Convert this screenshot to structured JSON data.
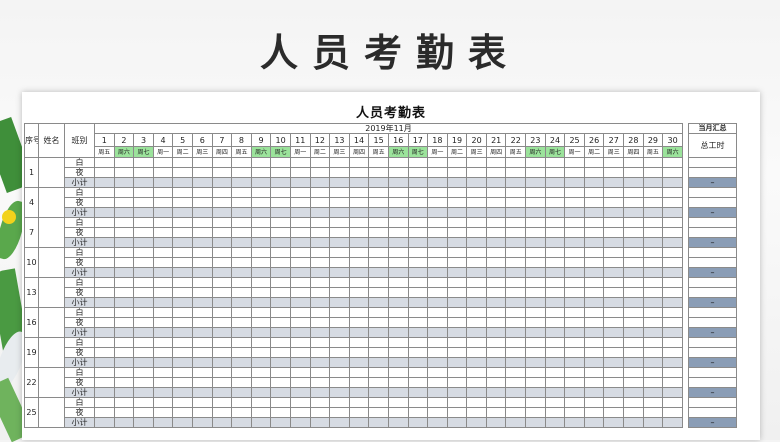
{
  "page_title": "人员考勤表",
  "sheet": {
    "title": "人员考勤表",
    "month": "2019年11月",
    "headers": {
      "seq": "序号",
      "name": "姓名",
      "shift": "班别",
      "summary": "当月汇总",
      "total_hours": "总工时"
    },
    "days": [
      {
        "n": "1",
        "w": "周五",
        "we": false
      },
      {
        "n": "2",
        "w": "周六",
        "we": true
      },
      {
        "n": "3",
        "w": "周七",
        "we": true
      },
      {
        "n": "4",
        "w": "周一",
        "we": false
      },
      {
        "n": "5",
        "w": "周二",
        "we": false
      },
      {
        "n": "6",
        "w": "周三",
        "we": false
      },
      {
        "n": "7",
        "w": "周四",
        "we": false
      },
      {
        "n": "8",
        "w": "周五",
        "we": false
      },
      {
        "n": "9",
        "w": "周六",
        "we": true
      },
      {
        "n": "10",
        "w": "周七",
        "we": true
      },
      {
        "n": "11",
        "w": "周一",
        "we": false
      },
      {
        "n": "12",
        "w": "周二",
        "we": false
      },
      {
        "n": "13",
        "w": "周三",
        "we": false
      },
      {
        "n": "14",
        "w": "周四",
        "we": false
      },
      {
        "n": "15",
        "w": "周五",
        "we": false
      },
      {
        "n": "16",
        "w": "周六",
        "we": true
      },
      {
        "n": "17",
        "w": "周七",
        "we": true
      },
      {
        "n": "18",
        "w": "周一",
        "we": false
      },
      {
        "n": "19",
        "w": "周二",
        "we": false
      },
      {
        "n": "20",
        "w": "周三",
        "we": false
      },
      {
        "n": "21",
        "w": "周四",
        "we": false
      },
      {
        "n": "22",
        "w": "周五",
        "we": false
      },
      {
        "n": "23",
        "w": "周六",
        "we": true
      },
      {
        "n": "24",
        "w": "周七",
        "we": true
      },
      {
        "n": "25",
        "w": "周一",
        "we": false
      },
      {
        "n": "26",
        "w": "周二",
        "we": false
      },
      {
        "n": "27",
        "w": "周三",
        "we": false
      },
      {
        "n": "28",
        "w": "周四",
        "we": false
      },
      {
        "n": "29",
        "w": "周五",
        "we": false
      },
      {
        "n": "30",
        "w": "周六",
        "we": true
      }
    ],
    "shift_labels": [
      "白",
      "夜",
      "小计"
    ],
    "employees": [
      "1",
      "4",
      "7",
      "10",
      "13",
      "16",
      "19",
      "22",
      "25"
    ],
    "subtotal_value": "–"
  },
  "colors": {
    "weekend": "#9be39b",
    "subtotal_row": "#d6dbe3",
    "summary_subtotal": "#8a9db6"
  }
}
